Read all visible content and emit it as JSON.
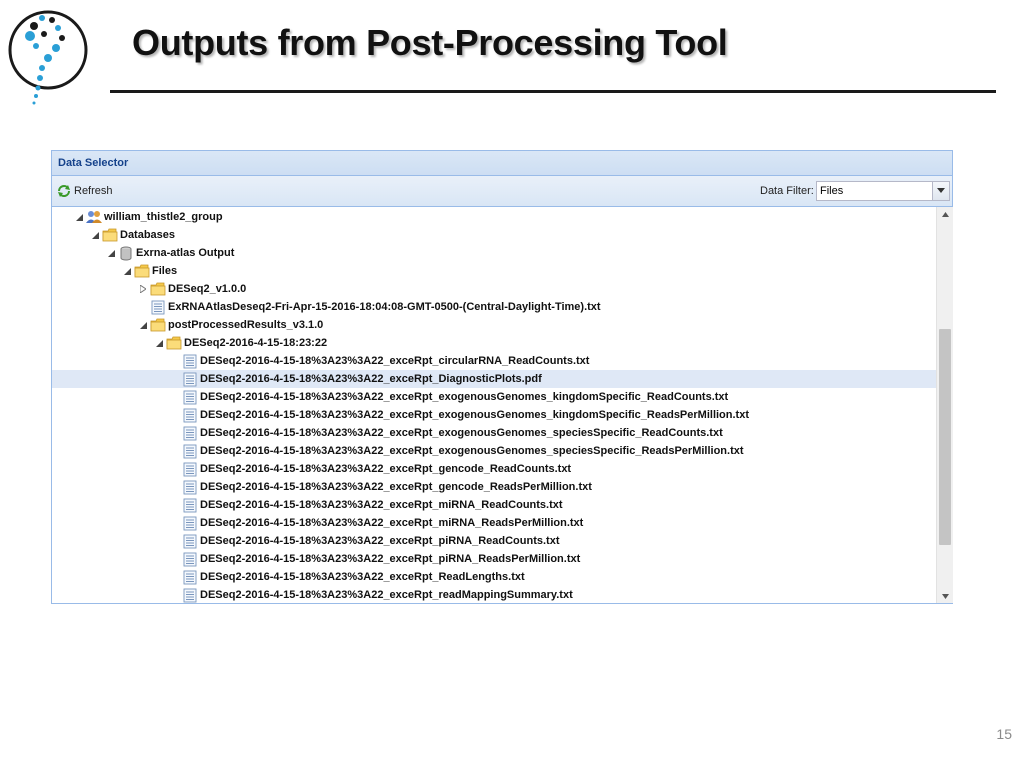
{
  "slide": {
    "title": "Outputs from Post-Processing Tool",
    "number": "15"
  },
  "panel": {
    "title": "Data Selector",
    "toolbar": {
      "refresh_label": "Refresh",
      "filter_label": "Data Filter:",
      "filter_value": "Files"
    }
  },
  "tree": {
    "nodes": [
      {
        "label": "william_thistle2_group",
        "icon": "group-icon",
        "level": 0,
        "state": "expanded"
      },
      {
        "label": "Databases",
        "icon": "folder-icon",
        "level": 1,
        "state": "expanded"
      },
      {
        "label": "Exrna-atlas Output",
        "icon": "database-icon",
        "level": 2,
        "state": "expanded"
      },
      {
        "label": "Files",
        "icon": "folder-icon",
        "level": 3,
        "state": "expanded"
      },
      {
        "label": "DESeq2_v1.0.0",
        "icon": "folder-icon",
        "level": 4,
        "state": "collapsed"
      },
      {
        "label": "ExRNAAtlasDeseq2-Fri-Apr-15-2016-18:04:08-GMT-0500-(Central-Daylight-Time).txt",
        "icon": "file-icon",
        "level": 4,
        "state": "leaf"
      },
      {
        "label": "postProcessedResults_v3.1.0",
        "icon": "folder-icon",
        "level": 4,
        "state": "expanded"
      },
      {
        "label": "DESeq2-2016-4-15-18:23:22",
        "icon": "folder-icon",
        "level": 5,
        "state": "expanded"
      },
      {
        "label": "DESeq2-2016-4-15-18%3A23%3A22_exceRpt_circularRNA_ReadCounts.txt",
        "icon": "file-icon",
        "level": 6,
        "state": "leaf"
      },
      {
        "label": "DESeq2-2016-4-15-18%3A23%3A22_exceRpt_DiagnosticPlots.pdf",
        "icon": "file-icon",
        "level": 6,
        "state": "leaf",
        "selected": true
      },
      {
        "label": "DESeq2-2016-4-15-18%3A23%3A22_exceRpt_exogenousGenomes_kingdomSpecific_ReadCounts.txt",
        "icon": "file-icon",
        "level": 6,
        "state": "leaf"
      },
      {
        "label": "DESeq2-2016-4-15-18%3A23%3A22_exceRpt_exogenousGenomes_kingdomSpecific_ReadsPerMillion.txt",
        "icon": "file-icon",
        "level": 6,
        "state": "leaf"
      },
      {
        "label": "DESeq2-2016-4-15-18%3A23%3A22_exceRpt_exogenousGenomes_speciesSpecific_ReadCounts.txt",
        "icon": "file-icon",
        "level": 6,
        "state": "leaf"
      },
      {
        "label": "DESeq2-2016-4-15-18%3A23%3A22_exceRpt_exogenousGenomes_speciesSpecific_ReadsPerMillion.txt",
        "icon": "file-icon",
        "level": 6,
        "state": "leaf"
      },
      {
        "label": "DESeq2-2016-4-15-18%3A23%3A22_exceRpt_gencode_ReadCounts.txt",
        "icon": "file-icon",
        "level": 6,
        "state": "leaf"
      },
      {
        "label": "DESeq2-2016-4-15-18%3A23%3A22_exceRpt_gencode_ReadsPerMillion.txt",
        "icon": "file-icon",
        "level": 6,
        "state": "leaf"
      },
      {
        "label": "DESeq2-2016-4-15-18%3A23%3A22_exceRpt_miRNA_ReadCounts.txt",
        "icon": "file-icon",
        "level": 6,
        "state": "leaf"
      },
      {
        "label": "DESeq2-2016-4-15-18%3A23%3A22_exceRpt_miRNA_ReadsPerMillion.txt",
        "icon": "file-icon",
        "level": 6,
        "state": "leaf"
      },
      {
        "label": "DESeq2-2016-4-15-18%3A23%3A22_exceRpt_piRNA_ReadCounts.txt",
        "icon": "file-icon",
        "level": 6,
        "state": "leaf"
      },
      {
        "label": "DESeq2-2016-4-15-18%3A23%3A22_exceRpt_piRNA_ReadsPerMillion.txt",
        "icon": "file-icon",
        "level": 6,
        "state": "leaf"
      },
      {
        "label": "DESeq2-2016-4-15-18%3A23%3A22_exceRpt_ReadLengths.txt",
        "icon": "file-icon",
        "level": 6,
        "state": "leaf"
      },
      {
        "label": "DESeq2-2016-4-15-18%3A23%3A22_exceRpt_readMappingSummary.txt",
        "icon": "file-icon",
        "level": 6,
        "state": "leaf"
      }
    ]
  },
  "colors": {
    "panel_border": "#99bbe8",
    "header_text": "#15428b",
    "selection": "#dfe8f6",
    "folder": "#f5c94a"
  }
}
